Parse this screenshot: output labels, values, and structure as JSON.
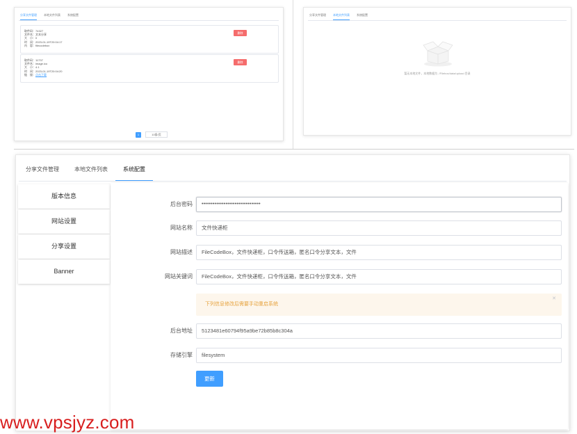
{
  "screen_top_left": {
    "tabs": [
      "分享文件管理",
      "本地文件列表",
      "系统配置"
    ],
    "active_tab_index": 0,
    "files": [
      {
        "rows": [
          {
            "label": "取件码：",
            "value": "74327"
          },
          {
            "label": "文件名：",
            "value": "文本分享"
          },
          {
            "label": "大　小：",
            "value": "0"
          },
          {
            "label": "时　间：",
            "value": "2023-01-19T20:04:17"
          },
          {
            "label": "内　容：",
            "value": "filecodebox"
          }
        ],
        "delete_label": "删除"
      },
      {
        "rows": [
          {
            "label": "取件码：",
            "value": "11737"
          },
          {
            "label": "文件名：",
            "value": "image.ico"
          },
          {
            "label": "大　小：",
            "value": "4.1"
          },
          {
            "label": "时　间：",
            "value": "2023-01-19T20:04:20"
          },
          {
            "label": "链　接：",
            "value": "点击下载",
            "is_link": true
          }
        ],
        "delete_label": "删除"
      }
    ],
    "pagination": {
      "current_page": "1",
      "page_size": "10条/页"
    }
  },
  "screen_top_right": {
    "tabs": [
      "分享文件管理",
      "本地文件列表",
      "系统配置"
    ],
    "active_tab_index": 1,
    "empty_text": "暂无本地文件，本地数据为 ./Filebox/data/upload 目录"
  },
  "main": {
    "tabs": [
      {
        "label": "分享文件管理"
      },
      {
        "label": "本地文件列表"
      },
      {
        "label": "系统配置"
      }
    ],
    "active_tab_index": 2,
    "sidebar": [
      {
        "label": "版本信息"
      },
      {
        "label": "网站设置"
      },
      {
        "label": "分享设置"
      },
      {
        "label": "Banner"
      }
    ],
    "form": {
      "admin_password": {
        "label": "后台密码",
        "value": "••••••••••••••••••••••••••••••••"
      },
      "site_name": {
        "label": "网站名称",
        "value": "文件快递柜"
      },
      "site_description": {
        "label": "网站描述",
        "value": "FileCodeBox，文件快递柜，口令传送箱，匿名口令分享文本，文件"
      },
      "site_keywords": {
        "label": "网站关键词",
        "value": "FileCodeBox，文件快递柜，口令传送箱，匿名口令分享文本，文件"
      },
      "alert_text": "下列信息修改后需要手动重启系统",
      "admin_address": {
        "label": "后台地址",
        "value": "5123481e60794f95a9be72b85b8c304a"
      },
      "storage_engine": {
        "label": "存储引擎",
        "value": "filesystem"
      },
      "submit_label": "更新"
    }
  },
  "watermark": "www.vpsjyz.com",
  "colors": {
    "primary": "#409eff",
    "danger": "#f56c6c",
    "warning_bg": "#fdf6ec",
    "warning_text": "#e6a23c",
    "watermark": "#d81e1e"
  }
}
